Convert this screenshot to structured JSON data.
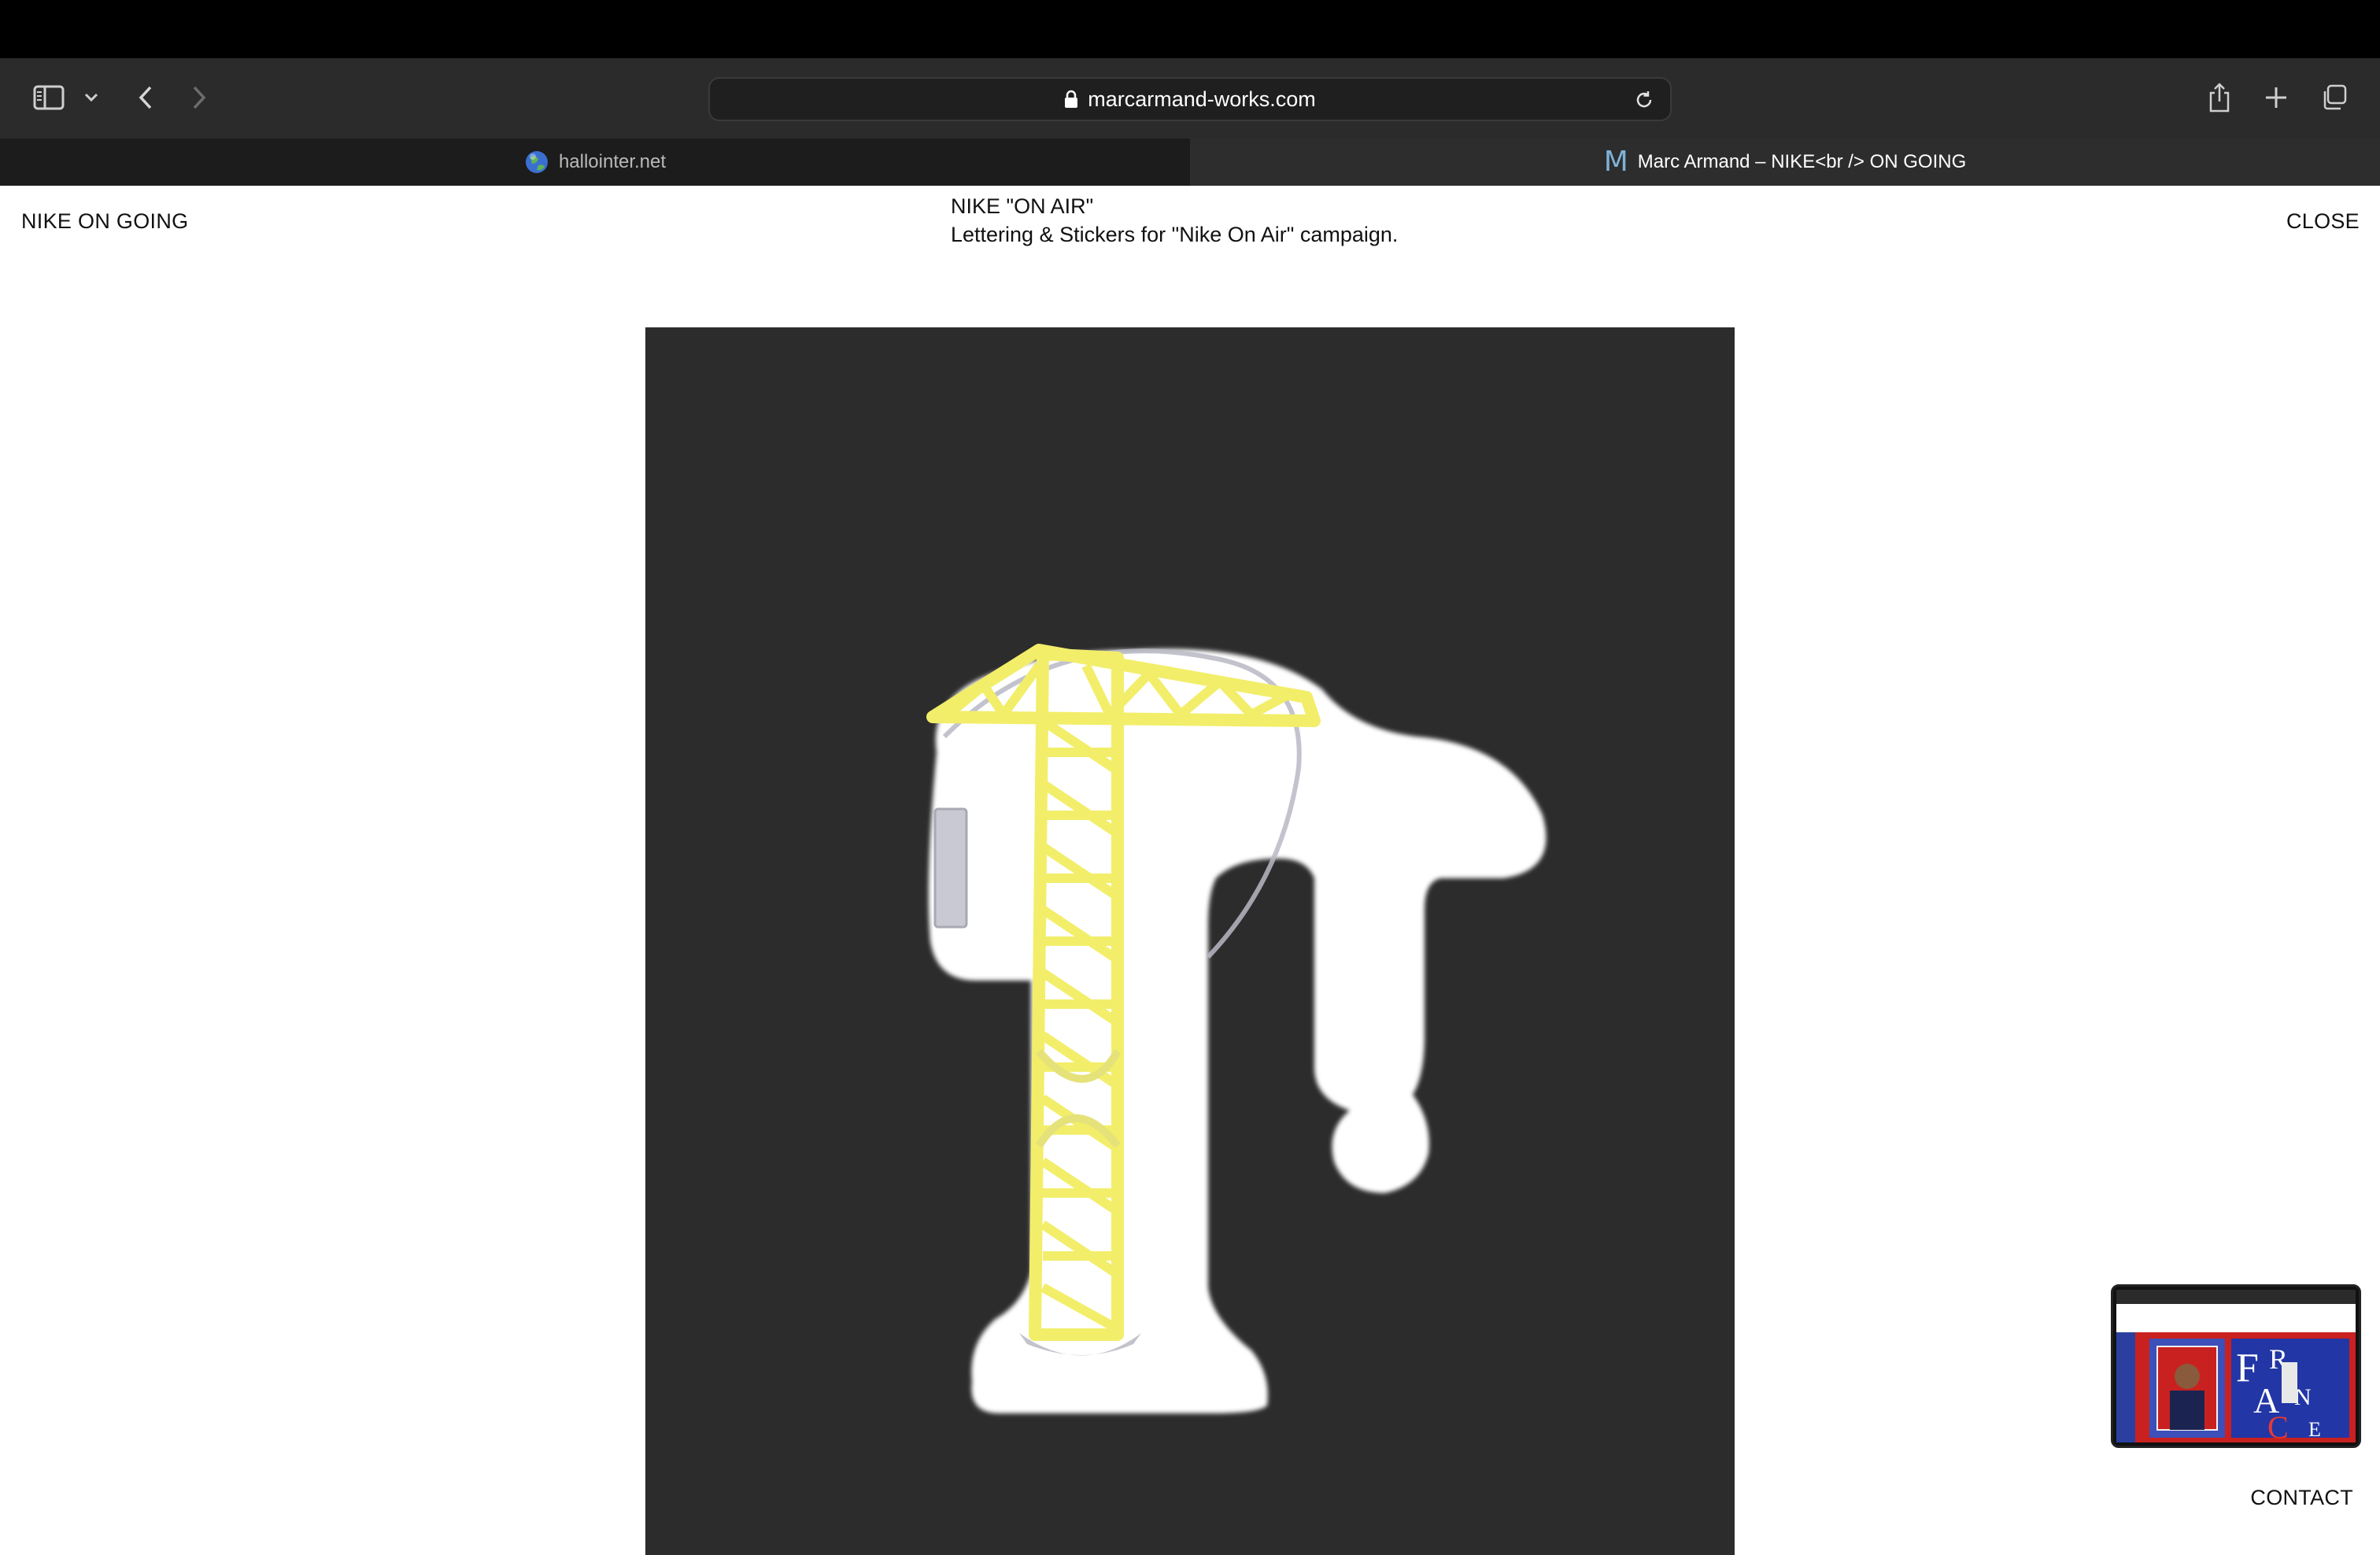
{
  "browser": {
    "url": "marcarmand-works.com",
    "tabs": [
      {
        "label": "hallointer.net",
        "active": false,
        "favicon": "globe-icon"
      },
      {
        "label": "Marc Armand – NIKE<br /> ON GOING",
        "active": true,
        "favicon": "M"
      }
    ]
  },
  "page": {
    "site_title": "NIKE ON GOING",
    "project_title": "NIKE \"ON AIR\"",
    "project_description": "Lettering & Stickers for \"Nike On Air\" campaign.",
    "close_label": "CLOSE",
    "contact_label": "CONTACT"
  },
  "colors": {
    "toolbar": "#2b2b2b",
    "artwork_background": "#2c2c2c",
    "crane_yellow": "#f2ee6a"
  }
}
